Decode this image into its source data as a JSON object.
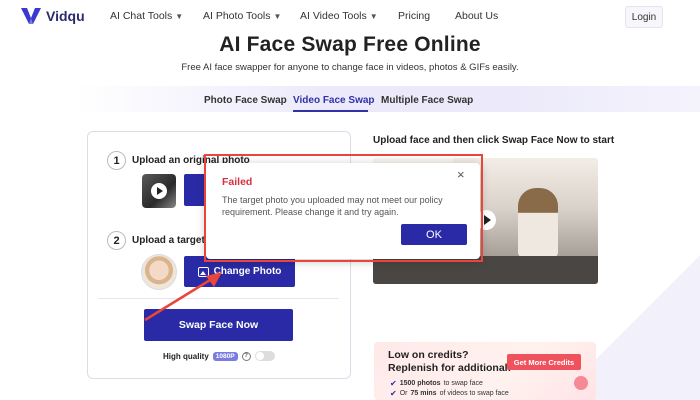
{
  "brand": {
    "name": "Vidqu",
    "accent": "#2a2aa6"
  },
  "nav": {
    "items": [
      {
        "label": "AI Chat Tools",
        "dropdown": true
      },
      {
        "label": "AI Photo Tools",
        "dropdown": true
      },
      {
        "label": "AI Video Tools",
        "dropdown": true
      },
      {
        "label": "Pricing",
        "dropdown": false
      },
      {
        "label": "About Us",
        "dropdown": false
      }
    ],
    "login": "Login"
  },
  "hero": {
    "title": "AI Face Swap Free Online",
    "subtitle": "Free AI face swapper for anyone to change face in videos, photos & GIFs easily."
  },
  "tabs": [
    {
      "label": "Photo Face Swap",
      "active": false
    },
    {
      "label": "Video Face Swap",
      "active": true
    },
    {
      "label": "Multiple Face Swap",
      "active": false
    }
  ],
  "left_card": {
    "step1": {
      "num": "1",
      "label": "Upload an original photo"
    },
    "step2": {
      "num": "2",
      "label": "Upload a target face",
      "button": "Change Photo"
    },
    "swap_button": "Swap Face Now",
    "high_quality": {
      "label": "High quality",
      "badge": "1080P",
      "help": "?",
      "enabled": false
    }
  },
  "right": {
    "heading": "Upload face and then click Swap Face Now to start"
  },
  "promo": {
    "title_line1": "Low on credits?",
    "title_line2": "Replenish for additional:",
    "button": "Get More Credits",
    "line1_bold": "1500 photos",
    "line1_rest": "to swap face",
    "line2_pre": "Or",
    "line2_bold": "75 mins",
    "line2_rest": "of videos to swap face"
  },
  "modal": {
    "title": "Failed",
    "close": "×",
    "message": "The target photo you uploaded may not meet our policy requirement. Please change it and try again.",
    "ok": "OK"
  },
  "colors": {
    "error_red": "#d6303f",
    "annotation_red": "#e8463a",
    "promo_button": "#f0525d"
  }
}
